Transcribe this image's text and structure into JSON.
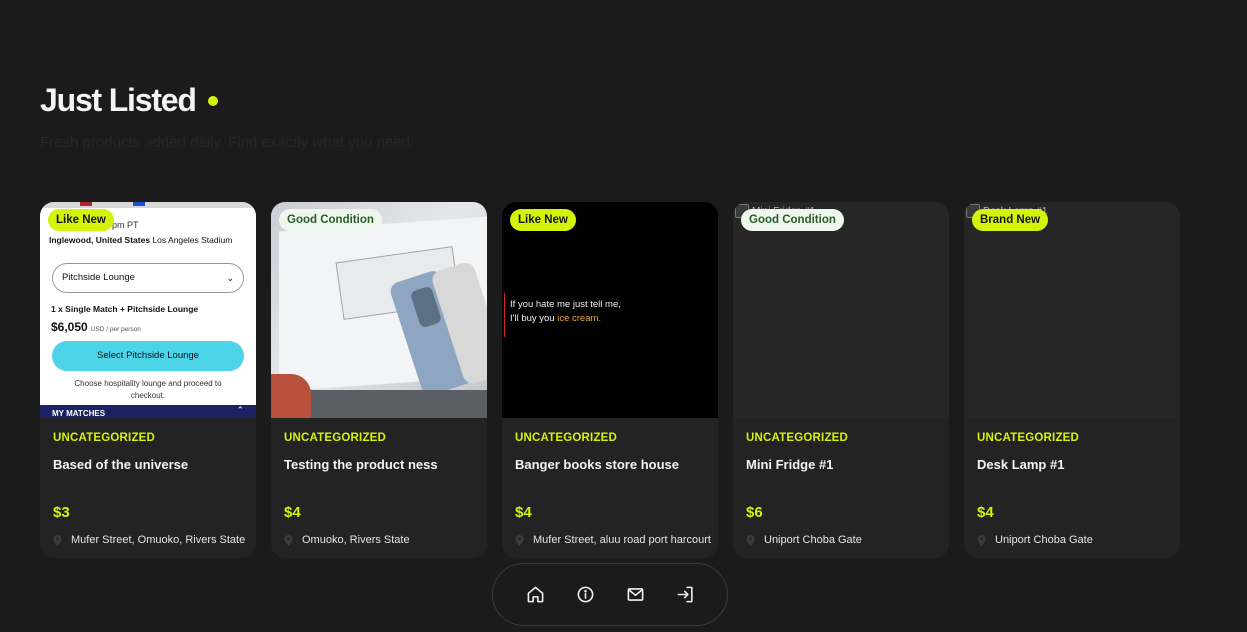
{
  "section": {
    "title": "Just Listed",
    "subtitle": "Fresh products added daily. Find exactly what you need."
  },
  "products": [
    {
      "badge": "Like New",
      "category": "UNCATEGORIZED",
      "name": "Based of the universe",
      "price": "$3",
      "location": "Mufer Street, Omuoko, Rivers State",
      "image": {
        "time": "pm PT",
        "venue_city": "Inglewood, United States",
        "venue_name": "Los Angeles Stadium",
        "select_value": "Pitchside Lounge",
        "package": "1 x Single Match + Pitchside Lounge",
        "amount": "$6,050",
        "amount_unit": "USD / per person",
        "cta": "Select Pitchside Lounge",
        "hint": "Choose hospitality lounge and proceed to checkout.",
        "footer": "MY MATCHES"
      }
    },
    {
      "badge": "Good Condition",
      "category": "UNCATEGORIZED",
      "name": "Testing the product ness",
      "price": "$4",
      "location": "Omuoko, Rivers State"
    },
    {
      "badge": "Like New",
      "category": "UNCATEGORIZED",
      "name": "Banger books store house",
      "price": "$4",
      "location": "Mufer Street, aluu road port harcourt",
      "image": {
        "line1": "If you hate me just tell me,",
        "line2_prefix": "I'll buy you ",
        "line2_accent": "ice cream."
      }
    },
    {
      "badge": "Good Condition",
      "category": "UNCATEGORIZED",
      "name": "Mini Fridge #1",
      "price": "$6",
      "location": "Uniport Choba Gate",
      "image_alt": "Mini Fridge #1"
    },
    {
      "badge": "Brand New",
      "category": "UNCATEGORIZED",
      "name": "Desk Lamp #1",
      "price": "$4",
      "location": "Uniport Choba Gate",
      "image_alt": "Desk Lamp #1"
    }
  ],
  "nav": {
    "items": [
      "home-icon",
      "info-icon",
      "mail-icon",
      "login-icon"
    ]
  },
  "colors": {
    "accent": "#d4f20a",
    "background": "#1b1b1b",
    "card": "#232323"
  }
}
